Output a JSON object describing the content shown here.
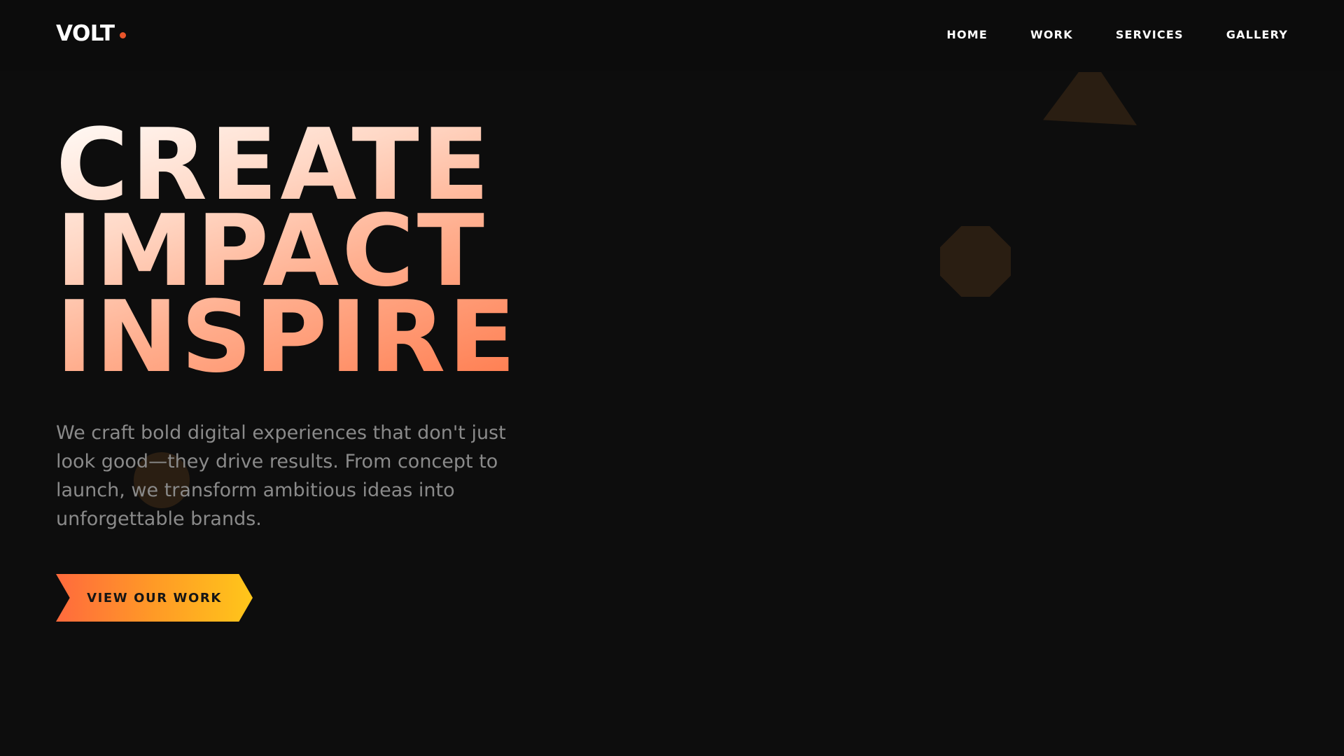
{
  "brand": {
    "name": "VOLT",
    "accent_color": "#e8542a"
  },
  "nav": {
    "items": [
      {
        "label": "HOME"
      },
      {
        "label": "WORK"
      },
      {
        "label": "SERVICES"
      },
      {
        "label": "GALLERY"
      }
    ]
  },
  "hero": {
    "title_lines": [
      "CREATE",
      "IMPACT",
      "INSPIRE"
    ],
    "description": "We craft bold digital experiences that don't just look good—they drive results. From concept to launch, we transform ambitious ideas into unforgettable brands.",
    "cta_label": "VIEW OUR WORK",
    "cta_gradient": [
      "#ff6a3d",
      "#ffc61a"
    ]
  },
  "colors": {
    "background": "#0d0d0d",
    "text_primary": "#ffffff",
    "text_muted": "#8a8a8a",
    "shape_fill": "#2a1e12"
  },
  "decorations": {
    "shapes": [
      {
        "kind": "triangle-icon"
      },
      {
        "kind": "octagon-icon"
      },
      {
        "kind": "circle-icon"
      }
    ]
  }
}
